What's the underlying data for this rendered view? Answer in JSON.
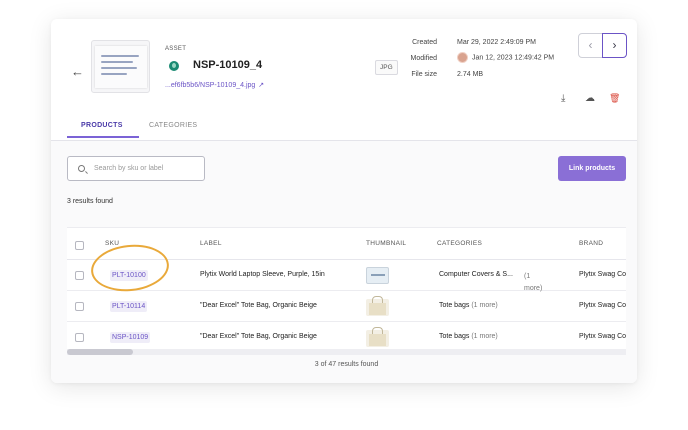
{
  "asset": {
    "tag": "ASSET",
    "title": "NSP-10109_4",
    "link": "...ef6fb5b6/NSP-10109_4.jpg",
    "format": "JPG",
    "created_label": "Created",
    "created_value": "Mar 29, 2022 2:49:09 PM",
    "modified_label": "Modified",
    "modified_value": "Jan 12, 2023 12:49:42 PM",
    "filesize_label": "File size",
    "filesize_value": "2.74 MB"
  },
  "nav": {
    "prev": "‹",
    "next": "›",
    "back": "←"
  },
  "actions": {
    "download": "⤓",
    "upload": "☁",
    "delete": "🗑"
  },
  "tabs": [
    {
      "label": "PRODUCTS"
    },
    {
      "label": "CATEGORIES"
    }
  ],
  "search": {
    "placeholder": "Search by sku or label"
  },
  "link_button": "Link products",
  "results_text": "3 results found",
  "table": {
    "headers": [
      "SKU",
      "LABEL",
      "THUMBNAIL",
      "CATEGORIES",
      "BRAND"
    ],
    "rows": [
      {
        "sku": "PLT-10100",
        "label": "Plytix World Laptop Sleeve, Purple, 15in",
        "category": "Computer Covers & S...",
        "more": "(1 more)",
        "brand": "Plytix Swag Co"
      },
      {
        "sku": "PLT-10114",
        "label": "\"Dear Excel\" Tote Bag, Organic Beige",
        "category": "Tote bags",
        "more": "(1 more)",
        "brand": "Plytix Swag Co"
      },
      {
        "sku": "NSP-10109",
        "label": "\"Dear Excel\" Tote Bag, Organic Beige",
        "category": "Tote bags",
        "more": "(1 more)",
        "brand": "Plytix Swag Co"
      }
    ]
  },
  "footer_text": "3 of 47 results found",
  "colors": {
    "accent": "#6b54c6",
    "button": "#8a6fd6",
    "highlight": "#e9a93a"
  }
}
